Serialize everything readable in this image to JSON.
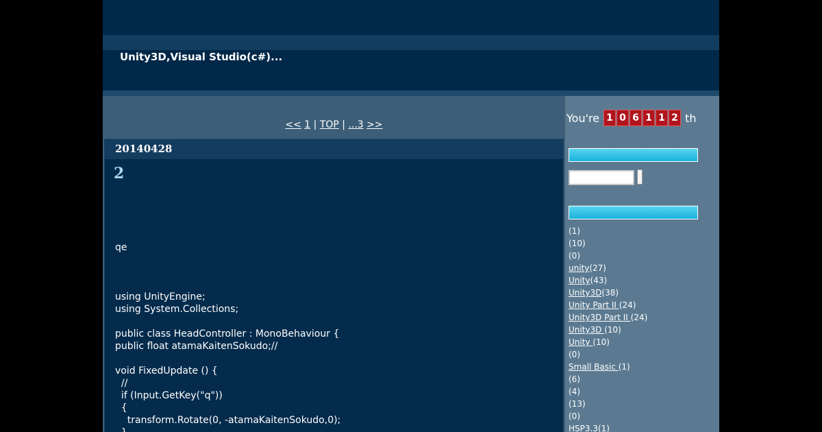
{
  "header": {
    "title": "Unity3D,Visual Studio(c#)..."
  },
  "pager": {
    "prev": "<<",
    "page_1": "1",
    "sep1": "|",
    "top": "TOP",
    "sep2": "|",
    "page_3": "...3",
    "next": ">>"
  },
  "entry": {
    "date": "20140428",
    "title": "2",
    "body_lines": [
      "qe",
      "",
      "",
      "",
      "using UnityEngine;",
      "using System.Collections;",
      "",
      "public class HeadController : MonoBehaviour {",
      "public float atamaKaitenSokudo;//",
      "",
      "void FixedUpdate () {",
      "  //",
      "  if (Input.GetKey(\"q\"))",
      "  {",
      "    transform.Rotate(0, -atamaKaitenSokudo,0);",
      "  }"
    ]
  },
  "sidebar": {
    "counter_prefix": "You're",
    "counter_digits": [
      "1",
      "0",
      "6",
      "1",
      "1",
      "2"
    ],
    "counter_suffix": "th",
    "categories": [
      {
        "link": "",
        "count": "(1)"
      },
      {
        "link": "",
        "count": "(10)"
      },
      {
        "link": "",
        "count": "(0)"
      },
      {
        "link": "unity",
        "count": "(27)"
      },
      {
        "link": "Unity",
        "count": "(43)"
      },
      {
        "link": "Unity3D",
        "count": "(38)"
      },
      {
        "link": "Unity Part II ",
        "count": "(24)"
      },
      {
        "link": "Unity3D Part II ",
        "count": "(24)"
      },
      {
        "link": "Unity3D ",
        "count": "(10)"
      },
      {
        "link": "Unity ",
        "count": "(10)"
      },
      {
        "link": "",
        "count": "(0)"
      },
      {
        "link": "Small Basic ",
        "count": "(1)"
      },
      {
        "link": "",
        "count": "(6)"
      },
      {
        "link": "",
        "count": "(4)"
      },
      {
        "link": "",
        "count": "(13)"
      },
      {
        "link": "",
        "count": "(0)"
      },
      {
        "link": "HSP3.3",
        "count": "(1)"
      }
    ]
  }
}
